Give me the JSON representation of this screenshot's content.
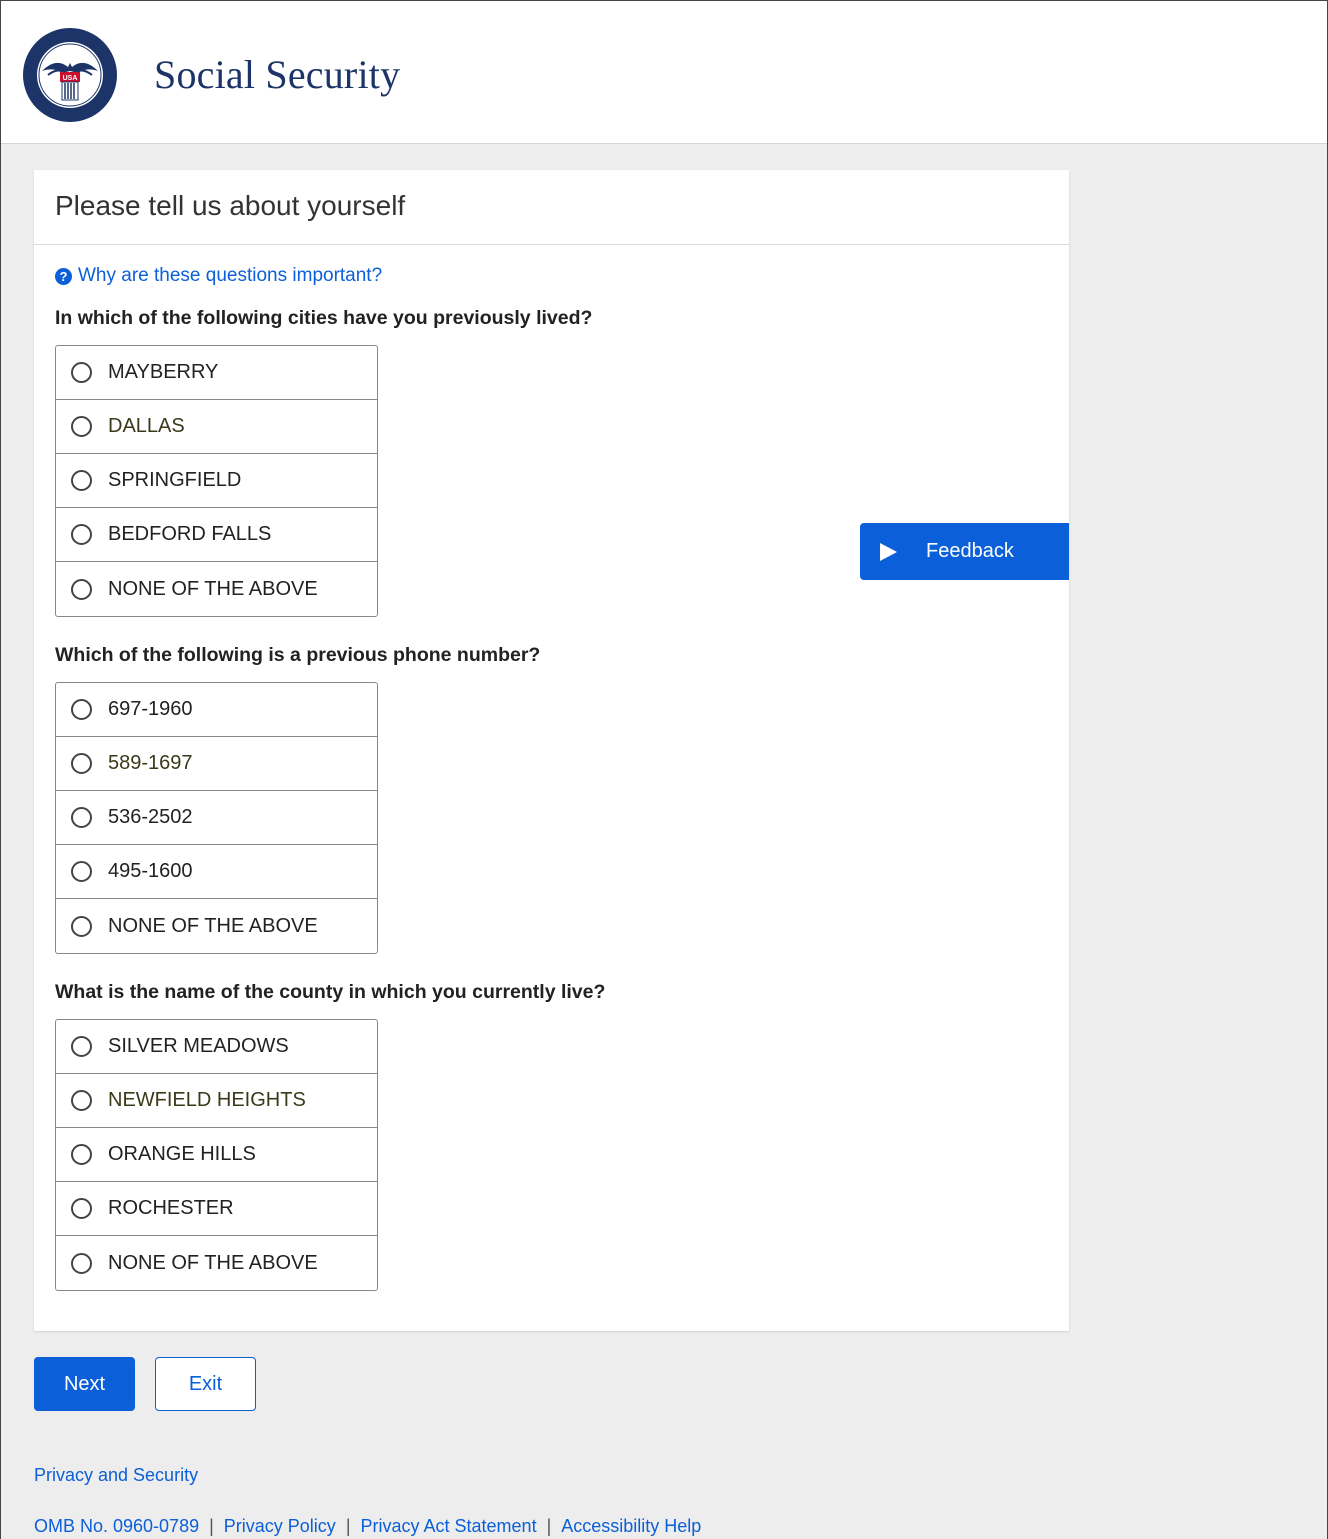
{
  "header": {
    "brand": "Social Security",
    "logo_icon": "ssa-seal-icon",
    "logo_text_top": "SOCIAL SECURITY",
    "logo_text_bottom": "ADMINISTRATION",
    "logo_badge": "USA"
  },
  "page": {
    "title": "Please tell us about yourself",
    "help_link": "Why are these questions important?",
    "help_icon": "question-circle-icon"
  },
  "questions": [
    {
      "label": "In which of the following cities have you previously lived?",
      "options": [
        "MAYBERRY",
        "DALLAS",
        "SPRINGFIELD",
        "BEDFORD FALLS",
        "NONE OF THE ABOVE"
      ]
    },
    {
      "label": "Which of the following is a previous phone number?",
      "options": [
        "697-1960",
        "589-1697",
        "536-2502",
        "495-1600",
        "NONE OF THE ABOVE"
      ]
    },
    {
      "label": "What is the name of the county in which you currently live?",
      "options": [
        "SILVER MEADOWS",
        "NEWFIELD HEIGHTS",
        "ORANGE HILLS",
        "ROCHESTER",
        "NONE OF THE ABOVE"
      ]
    }
  ],
  "feedback": {
    "label": "Feedback",
    "icon": "play-icon"
  },
  "actions": {
    "next": "Next",
    "exit": "Exit"
  },
  "footer": {
    "privacy_security": "Privacy and Security",
    "omb": "OMB No. 0960-0789",
    "privacy_policy": "Privacy Policy",
    "privacy_act": "Privacy Act Statement",
    "accessibility": "Accessibility Help",
    "separator": "|"
  },
  "colors": {
    "accent": "#0b5fd8",
    "brand": "#1d3469",
    "background": "#ededed"
  }
}
